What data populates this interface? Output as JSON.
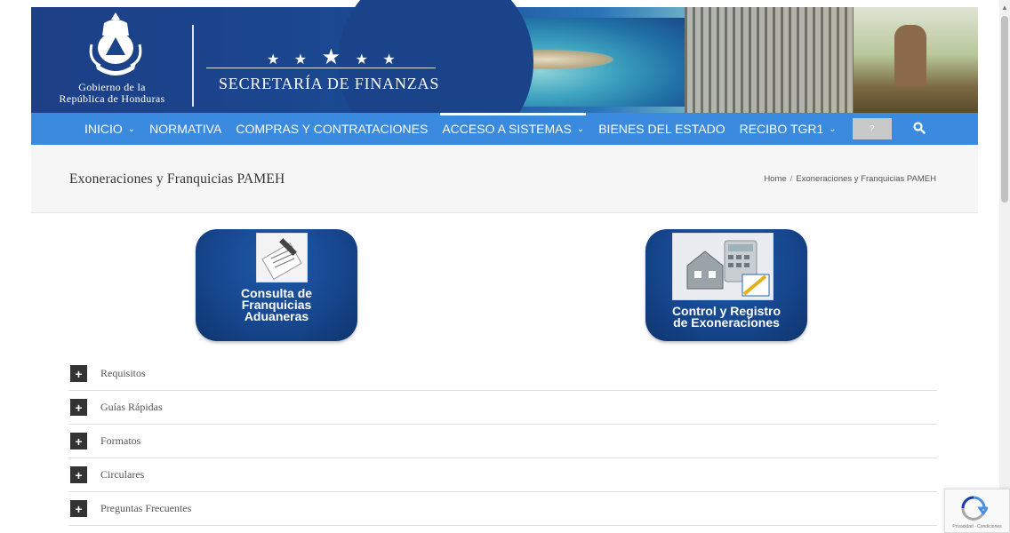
{
  "header": {
    "gov_line1": "Gobierno de la",
    "gov_line2": "República de Honduras",
    "secretaria": "SECRETARÍA DE FINANZAS",
    "stars_small": "★ ★",
    "stars_big": "★",
    "stars_small2": "★ ★"
  },
  "nav": {
    "items": [
      {
        "label": "INICIO",
        "chevron": "⌄"
      },
      {
        "label": "NORMATIVA"
      },
      {
        "label": "COMPRAS Y CONTRATACIONES"
      },
      {
        "label": "ACCESO A SISTEMAS",
        "chevron": "⌄"
      },
      {
        "label": "BIENES DEL ESTADO"
      },
      {
        "label": "RECIBO TGR1",
        "chevron": "⌄"
      }
    ],
    "box_label": "?"
  },
  "title_bar": {
    "title": "Exoneraciones y Franquicias PAMEH",
    "breadcrumb": [
      "Home",
      "/",
      "Exoneraciones y Franquicias PAMEH"
    ]
  },
  "tiles": [
    {
      "line1": "Consulta de",
      "line2": "Franquicias",
      "line3": "Aduaneras"
    },
    {
      "line1": "Control y Registro",
      "line2": "de Exoneraciones"
    }
  ],
  "accordion": [
    {
      "icon": "+",
      "label": "Requisitos"
    },
    {
      "icon": "+",
      "label": "Guías Rápidas"
    },
    {
      "icon": "+",
      "label": "Formatos"
    },
    {
      "icon": "+",
      "label": "Circulares"
    },
    {
      "icon": "+",
      "label": "Preguntas Frecuentes"
    }
  ],
  "recaptcha": {
    "text": "Privacidad - Condiciones"
  },
  "colors": {
    "nav_blue": "#3a8be0",
    "tile_blue": "#16478f",
    "banner_blue": "#1b4389"
  }
}
